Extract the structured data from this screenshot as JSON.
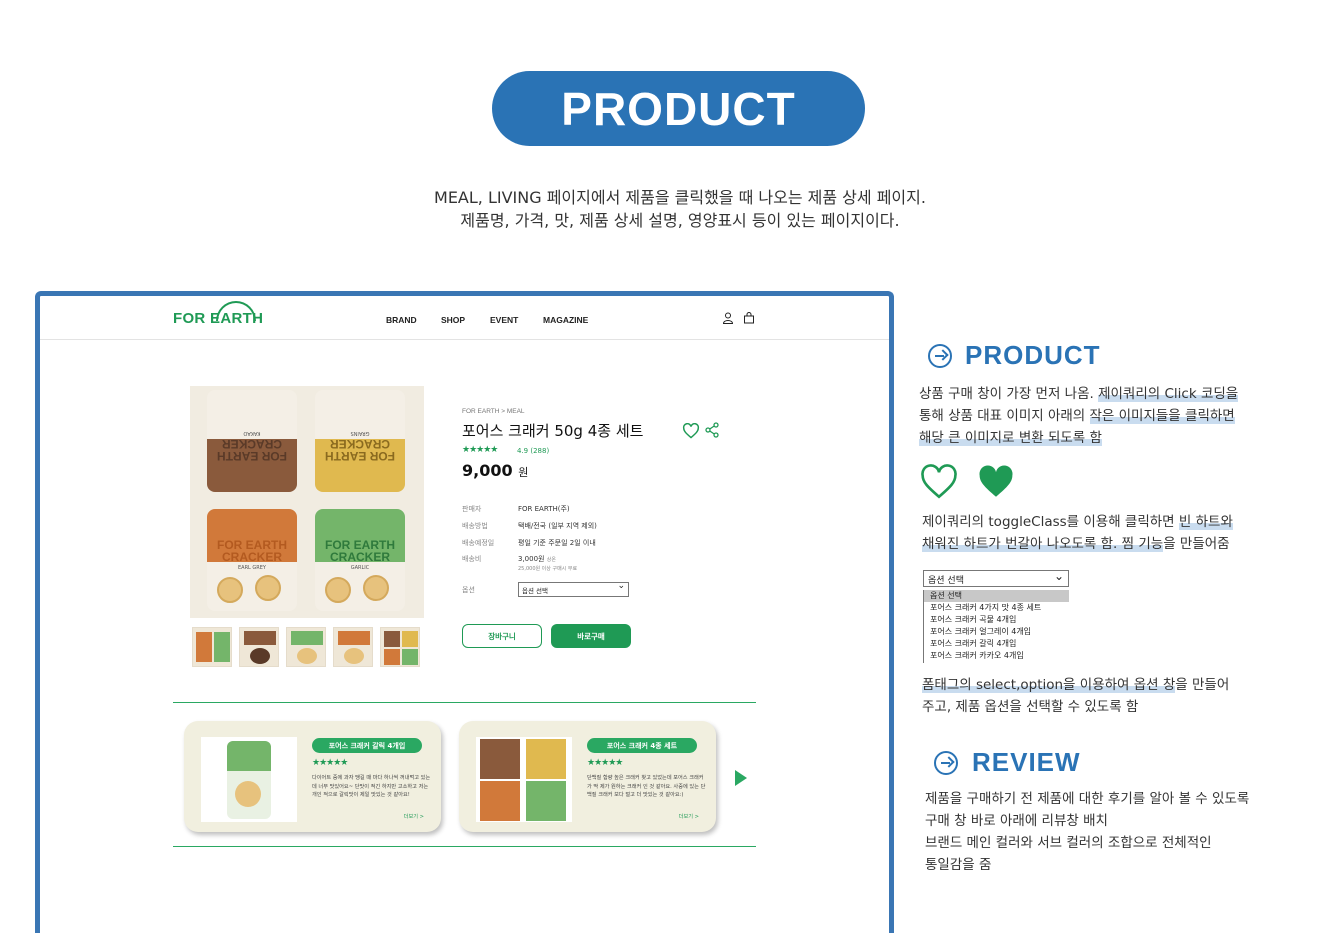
{
  "header": {
    "pill_title": "PRODUCT",
    "intro_line1": "MEAL, LIVING 페이지에서 제품을 클릭했을 때 나오는 제품 상세 페이지.",
    "intro_line2": "제품명, 가격, 맛, 제품 상세 설명, 영양표시 등이 있는 페이지이다."
  },
  "site": {
    "logo": "FOR EARTH",
    "menu": [
      "BRAND",
      "SHOP",
      "EVENT",
      "MAGAZINE"
    ],
    "icons": [
      "user-icon",
      "cart-icon"
    ]
  },
  "product": {
    "breadcrumb": "FOR EARTH > MEAL",
    "title": "포어스 크래커 50g 4종 세트",
    "stars": "★★★★★",
    "rating": "4.9 (288)",
    "price": "9,000",
    "currency": "원",
    "images": {
      "bags": [
        {
          "label": "FOR EARTH CRACKER",
          "sub": "KAKAO",
          "color": "#8a5a3c"
        },
        {
          "label": "FOR EARTH CRACKER",
          "sub": "GRAINS",
          "color": "#e0b94f"
        },
        {
          "label": "FOR EARTH CRACKER",
          "sub": "EARL GREY",
          "color": "#d1793a"
        },
        {
          "label": "FOR EARTH CRACKER",
          "sub": "GARLIC",
          "color": "#74b56a"
        }
      ]
    },
    "info": [
      {
        "key": "판매자",
        "value": "FOR EARTH(주)",
        "note": ""
      },
      {
        "key": "배송방법",
        "value": "택배/전국 (일부 지역 제외)",
        "note": ""
      },
      {
        "key": "배송예정일",
        "value": "평일 기준 주문일 2일 이내",
        "note": ""
      },
      {
        "key": "배송비",
        "value": "3,000원",
        "note": "25,000원 이상 구매시 무료"
      }
    ],
    "value_suffix": "상온",
    "option_label": "옵션",
    "option_selected": "옵션 선택",
    "cart_button": "장바구니",
    "buy_button": "바로구매"
  },
  "reviews": [
    {
      "tag": "포어스 크래커 갈릭 4개입",
      "stars": "★★★★★",
      "text": "다이어트 중에 과자 땡길 때 마다 하나씩 꺼내먹고 있는데 너무 맛있어요~ 단맛이 적긴 하지만 고소하고 저는 개인 적으로 갈릭맛이 제일 맛있는 것 같아요!",
      "more": "더보기 >"
    },
    {
      "tag": "포어스 크래커 4종 세트",
      "stars": "★★★★★",
      "text": "단백질 함량 높은 크래커 찾고 있었는데 포어스 크래커가 딱 제가 원하는 크래커 인 것 같아요. 사중에 있는 단백질 크래커 보다 덜고 더 맛있는 것 같아요:)",
      "more": "더보기 >"
    }
  ],
  "annotations": {
    "product_title": "PRODUCT",
    "product_note_a": "상품 구매 창이 가장 먼저 나옴. ",
    "product_note_b": "제이쿼리의 Click 코딩을",
    "product_note_c": "통해 상품 대표 이미지 아래의 ",
    "product_note_d": "작은 이미지들을 클릭하면",
    "product_note_e": "해당 큰 이미지로 변환 되도록 함",
    "heart_note_a": "제이쿼리의 toggleClass를 이용해 클릭하면 ",
    "heart_note_b": "빈 하트와",
    "heart_note_c": "채워진 하트가 번갈아 나오도록 함. 찜 기능",
    "heart_note_d": "을 만들어줌",
    "select_demo_selected": "옵션 선택",
    "select_options": [
      "옵션 선택",
      "포어스 크래커 4가지 맛 4종 세트",
      "포어스 크래커 곡물 4개입",
      "포어스 크래커 얼그레이 4개입",
      "포어스 크래커 갈릭 4개입",
      "포어스 크래커 카카오 4개입"
    ],
    "select_note_a": "폼태그의 select,option을 이용하여 옵션 창",
    "select_note_b": "을 만들어",
    "select_note_c": "주고, 제품 옵션을 선택할 수 있도록 함",
    "review_title": "REVIEW",
    "review_note_1": "제품을 구매하기 전 제품에 대한 후기를 알아 볼 수 있도록",
    "review_note_2": "구매 창 바로 아래에 리뷰창 배치",
    "review_note_3": "브랜드 메인 컬러와 서브 컬러의 조합으로 전체적인",
    "review_note_4": "통일감을 줌"
  },
  "colors": {
    "brand_blue": "#2a73b5",
    "brand_green": "#1f9a55",
    "card_bg": "#f1efdf"
  }
}
